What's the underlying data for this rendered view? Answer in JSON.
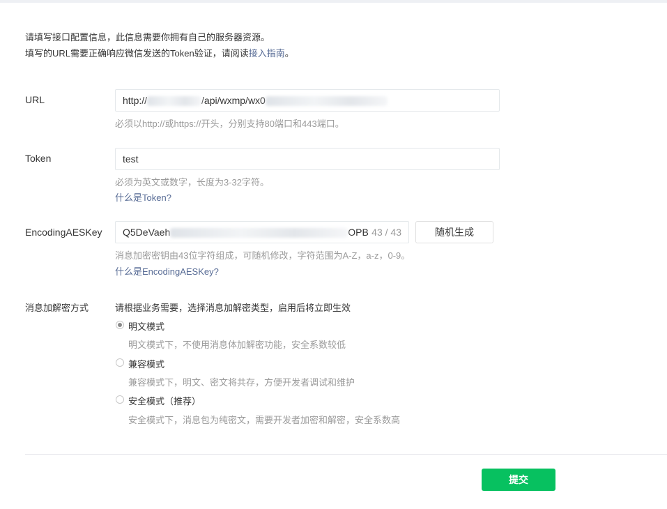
{
  "intro": {
    "line1": "请填写接口配置信息，此信息需要你拥有自己的服务器资源。",
    "line2_prefix": "填写的URL需要正确响应微信发送的Token验证，请阅读",
    "line2_link": "接入指南",
    "line2_suffix": "。"
  },
  "url": {
    "label": "URL",
    "value_visible": "http://",
    "value_visible2": "/api/wxmp/wx0",
    "hint": "必须以http://或https://开头，分别支持80端口和443端口。"
  },
  "token": {
    "label": "Token",
    "value": "test",
    "hint": "必须为英文或数字，长度为3-32字符。",
    "help_link": "什么是Token?"
  },
  "aes": {
    "label": "EncodingAESKey",
    "value_start": "Q5DeVaeh",
    "value_end": "OPB",
    "counter": "43 / 43",
    "generate_button": "随机生成",
    "hint": "消息加密密钥由43位字符组成，可随机修改，字符范围为A-Z，a-z，0-9。",
    "help_link": "什么是EncodingAESKey?"
  },
  "encryption": {
    "label": "消息加解密方式",
    "description": "请根据业务需要，选择消息加解密类型，启用后将立即生效",
    "options": [
      {
        "label": "明文模式",
        "desc": "明文模式下，不使用消息体加解密功能，安全系数较低",
        "checked": true
      },
      {
        "label": "兼容模式",
        "desc": "兼容模式下，明文、密文将共存，方便开发者调试和维护",
        "checked": false
      },
      {
        "label": "安全模式（推荐）",
        "desc": "安全模式下，消息包为纯密文，需要开发者加密和解密，安全系数高",
        "checked": false
      }
    ]
  },
  "submit_label": "提交"
}
